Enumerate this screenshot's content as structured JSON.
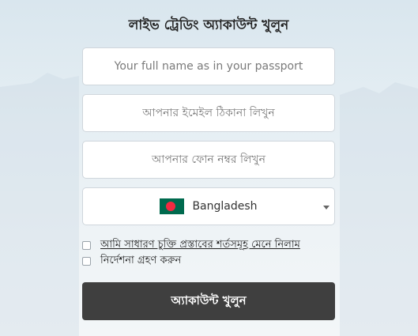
{
  "form": {
    "title": "লাইভ ট্রেডিং অ্যাকাউন্ট খুলুন",
    "name_placeholder": "Your full name as in your passport",
    "email_placeholder": "আপনার ইমেইল ঠিকানা লিখুন",
    "phone_placeholder": "আপনার ফোন নম্বর লিখুন",
    "country": {
      "selected": "Bangladesh",
      "flag_icon": "bangladesh-flag-icon",
      "flag_colors": [
        "#006a4e",
        "#f42a41"
      ]
    },
    "terms_label": "আমি সাধারণ চুক্তি প্রস্তাবের শর্তসমূহ মেনে নিলাম",
    "guide_label": "নির্দেশনা গ্রহণ করুন",
    "submit_label": "অ্যাকাউন্ট খুলুন"
  }
}
